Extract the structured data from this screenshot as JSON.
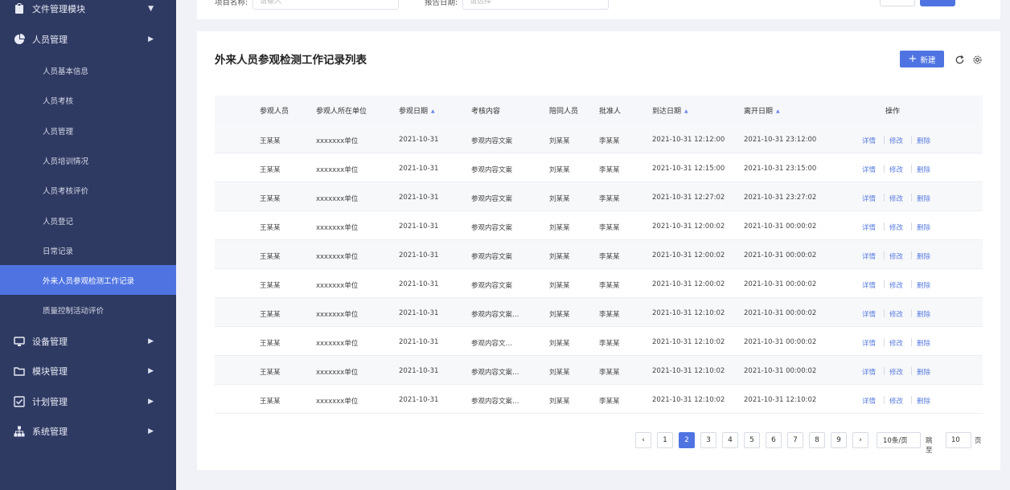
{
  "sidebar": {
    "items": [
      {
        "label": "文件管理模块",
        "icon": "clipboard-icon",
        "expanded": true
      },
      {
        "label": "人员管理",
        "icon": "pie-chart-icon"
      },
      {
        "label": "人员基本信息"
      },
      {
        "label": "人员考核"
      },
      {
        "label": "人员管理"
      },
      {
        "label": "人员培训情况"
      },
      {
        "label": "人员考核评价"
      },
      {
        "label": "人员登记"
      },
      {
        "label": "日常记录"
      },
      {
        "label": "外来人员参观检测工作记录"
      },
      {
        "label": "质量控制活动评价"
      },
      {
        "label": "设备管理",
        "icon": "device-icon"
      },
      {
        "label": "模块管理",
        "icon": "folder-icon"
      },
      {
        "label": "计划管理",
        "icon": "checklist-icon"
      },
      {
        "label": "系统管理",
        "icon": "org-chart-icon"
      }
    ]
  },
  "filters": {
    "project_label": "项目名称:",
    "project_placeholder": "请输入",
    "date_label": "报告日期:",
    "date_placeholder": "请选择"
  },
  "card": {
    "title": "外来人员参观检测工作记录列表",
    "new_label": "新建"
  },
  "table": {
    "headers": [
      "参观人员",
      "参观人所在单位",
      "参观日期",
      "考核内容",
      "陪同人员",
      "批准人",
      "到达日期",
      "离开日期",
      "操作"
    ],
    "actions": [
      "详情",
      "修改",
      "删除"
    ],
    "rows": [
      {
        "visitor": "王某某",
        "unit": "xxxxxxx单位",
        "date": "2021-10-31",
        "content": "参观内容文案",
        "companion": "刘某某",
        "approver": "李某某",
        "arrive": "2021-10-31 12:12:00",
        "leave": "2021-10-31 23:12:00"
      },
      {
        "visitor": "王某某",
        "unit": "xxxxxxx单位",
        "date": "2021-10-31",
        "content": "参观内容文案",
        "companion": "刘某某",
        "approver": "李某某",
        "arrive": "2021-10-31 12:15:00",
        "leave": "2021-10-31 23:15:00"
      },
      {
        "visitor": "王某某",
        "unit": "xxxxxxx单位",
        "date": "2021-10-31",
        "content": "参观内容文案",
        "companion": "刘某某",
        "approver": "李某某",
        "arrive": "2021-10-31 12:27:02",
        "leave": "2021-10-31 23:27:02"
      },
      {
        "visitor": "王某某",
        "unit": "xxxxxxx单位",
        "date": "2021-10-31",
        "content": "参观内容文案",
        "companion": "刘某某",
        "approver": "李某某",
        "arrive": "2021-10-31 12:00:02",
        "leave": "2021-10-31 00:00:02"
      },
      {
        "visitor": "王某某",
        "unit": "xxxxxxx单位",
        "date": "2021-10-31",
        "content": "参观内容文案",
        "companion": "刘某某",
        "approver": "李某某",
        "arrive": "2021-10-31 12:00:02",
        "leave": "2021-10-31 00:00:02"
      },
      {
        "visitor": "王某某",
        "unit": "xxxxxxx单位",
        "date": "2021-10-31",
        "content": "参观内容文案",
        "companion": "刘某某",
        "approver": "李某某",
        "arrive": "2021-10-31 12:00:02",
        "leave": "2021-10-31 00:00:02"
      },
      {
        "visitor": "王某某",
        "unit": "xxxxxxx单位",
        "date": "2021-10-31",
        "content": "参观内容文案…",
        "companion": "刘某某",
        "approver": "李某某",
        "arrive": "2021-10-31 12:10:02",
        "leave": "2021-10-31 00:00:02"
      },
      {
        "visitor": "王某某",
        "unit": "xxxxxxx单位",
        "date": "2021-10-31",
        "content": "参观内容文…",
        "companion": "刘某某",
        "approver": "李某某",
        "arrive": "2021-10-31 12:10:02",
        "leave": "2021-10-31 00:00:02"
      },
      {
        "visitor": "王某某",
        "unit": "xxxxxxx单位",
        "date": "2021-10-31",
        "content": "参观内容文案…",
        "companion": "刘某某",
        "approver": "李某某",
        "arrive": "2021-10-31 12:10:02",
        "leave": "2021-10-31 00:00:02"
      },
      {
        "visitor": "王某某",
        "unit": "xxxxxxx单位",
        "date": "2021-10-31",
        "content": "参观内容文案…",
        "companion": "刘某某",
        "approver": "李某某",
        "arrive": "2021-10-31 12:10:02",
        "leave": "2021-10-31 12:10:02"
      }
    ]
  },
  "pagination": {
    "prev": "‹",
    "next": "›",
    "pages": [
      "1",
      "2",
      "3",
      "4",
      "5",
      "6",
      "7",
      "8",
      "9"
    ],
    "active_page": "2",
    "page_size": "10条/页",
    "jump_label": "跳至",
    "jump_value": "10",
    "page_unit": "页"
  },
  "colors": {
    "sidebar_bg": "#2f3a62",
    "accent": "#4f74e2"
  }
}
